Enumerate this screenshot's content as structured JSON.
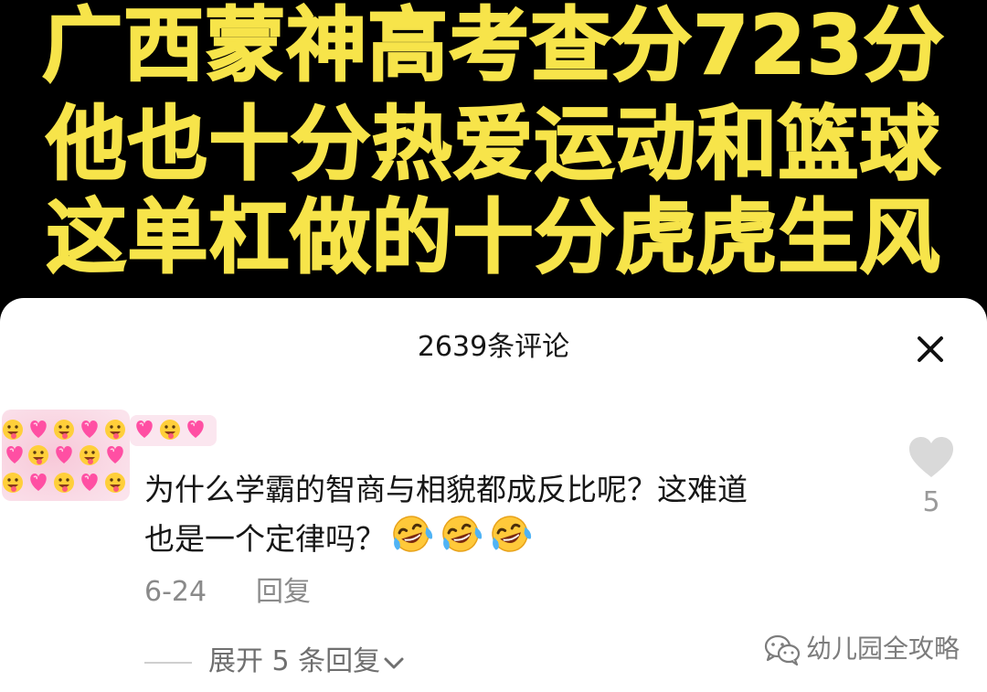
{
  "video": {
    "caption_lines": [
      "广西蒙神高考查分723分",
      "他也十分热爱运动和篮球",
      "这单杠做的十分虎虎生风"
    ],
    "caption_color": "#f7e44a"
  },
  "comments_panel": {
    "title": "2639条评论",
    "close_icon": "close-icon"
  },
  "comment": {
    "text_line1": "为什么学霸的智商与相貌都成反比呢？这难道",
    "text_line2": "也是一个定律吗？",
    "emojis": [
      "laughing-tears-emoji",
      "laughing-tears-emoji",
      "laughing-tears-emoji"
    ],
    "date": "6-24",
    "reply_label": "回复",
    "like_count": "5",
    "expand_label": "展开 5 条回复"
  },
  "watermark": {
    "text": "幼儿园全攻略",
    "icon": "wechat-icon"
  }
}
